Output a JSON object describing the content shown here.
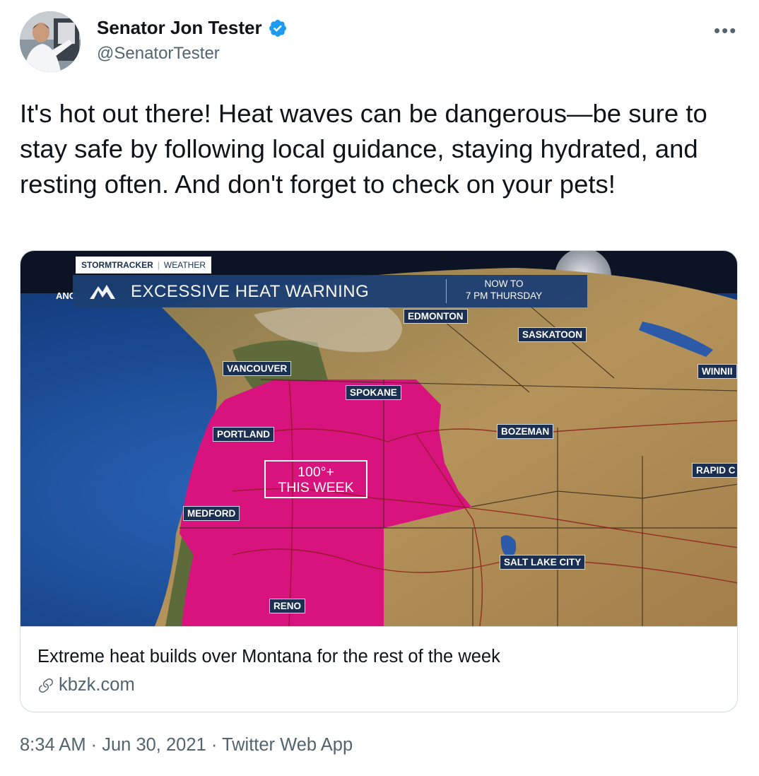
{
  "author": {
    "name": "Senator Jon Tester",
    "handle": "@SenatorTester",
    "verified": true
  },
  "more_icon": "more-horizontal-icon",
  "tweet": {
    "text": "It's hot out there! Heat waves can be dangerous—be sure to stay safe by following local guidance, staying hydrated, and resting often. And don't forget to check on your pets!"
  },
  "card": {
    "title": "Extreme heat builds over Montana for the rest of the week",
    "domain": "kbzk.com",
    "image": {
      "brand": "STORMTRACKER",
      "brand_sub": "WEATHER",
      "headline": "EXCESSIVE HEAT WARNING",
      "time_line1": "NOW TO",
      "time_line2": "7 PM THURSDAY",
      "partial_left_label": "ANC",
      "heat_line1": "100°+",
      "heat_line2": "THIS WEEK",
      "cities": {
        "edmonton": "EDMONTON",
        "saskatoon": "SASKATOON",
        "vancouver": "VANCOUVER",
        "winnipeg": "WINNII",
        "spokane": "SPOKANE",
        "portland": "PORTLAND",
        "bozeman": "BOZEMAN",
        "rapid_city": "RAPID C",
        "medford": "MEDFORD",
        "salt_lake_city": "SALT LAKE CITY",
        "reno": "RENO"
      },
      "colors": {
        "ocean": "#1b4e9c",
        "land": "#a88a55",
        "heat": "#d8137e",
        "banner": "#1c3f73"
      }
    }
  },
  "meta": {
    "time": "8:34 AM",
    "date": "Jun 30, 2021",
    "source": "Twitter Web App",
    "separator": "·"
  }
}
